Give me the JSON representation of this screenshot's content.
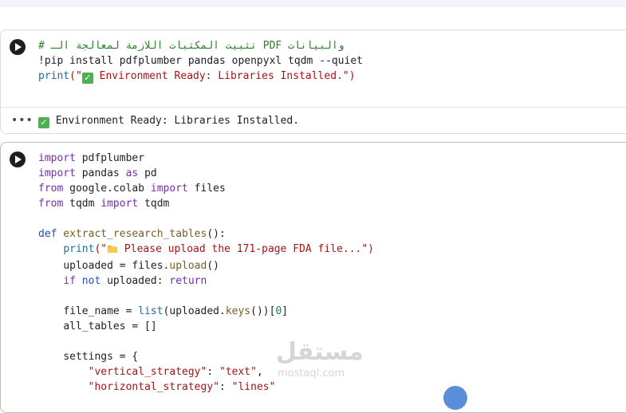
{
  "cells": [
    {
      "code": {
        "comment": "# تثبيت المكتبات اللازمة لمعالجة الـ PDF والبيانات",
        "pip_cmd": "!pip install pdfplumber pandas openpyxl tqdm --quiet",
        "print_fn": "print",
        "print_open": "(\"",
        "print_msg": " Environment Ready: Libraries Installed.",
        "print_close": "\")"
      },
      "output": {
        "menu": "•••",
        "text": " Environment Ready: Libraries Installed."
      }
    },
    {
      "lines": {
        "l1_kw": "import",
        "l1_mod": " pdfplumber",
        "l2_kw": "import",
        "l2_mod": " pandas ",
        "l2_as": "as",
        "l2_alias": " pd",
        "l3_kw": "from",
        "l3_mod": " google.colab ",
        "l3_imp": "import",
        "l3_name": " files",
        "l4_kw": "from",
        "l4_mod": " tqdm ",
        "l4_imp": "import",
        "l4_name": " tqdm",
        "l6_def": "def",
        "l6_fn": " extract_research_tables",
        "l6_rest": "():",
        "l7_fn": "print",
        "l7_open": "(\"",
        "l7_msg": " Please upload the 171-page FDA file...",
        "l7_close": "\")",
        "l8_a": "uploaded = files.",
        "l8_fn": "upload",
        "l8_b": "()",
        "l9_if": "if",
        "l9_not": "not",
        "l9_mid": " uploaded: ",
        "l9_ret": "return",
        "l11_a": "file_name = ",
        "l11_fn": "list",
        "l11_b": "(uploaded.",
        "l11_fn2": "keys",
        "l11_c": "())[",
        "l11_num": "0",
        "l11_d": "]",
        "l12": "all_tables = []",
        "l14": "settings = {",
        "l15_key": "\"vertical_strategy\"",
        "l15_sep": ": ",
        "l15_val": "\"text\"",
        "l15_end": ",",
        "l16_key": "\"horizontal_strategy\"",
        "l16_sep": ": ",
        "l16_val": "\"lines\""
      }
    }
  ],
  "watermark": {
    "arabic": "مستقل",
    "latin": "mostaql.com"
  },
  "colors": {
    "keyword": "#7c29b1",
    "string": "#a31515",
    "comment": "#2a7f2a",
    "check": "#4caf50"
  }
}
